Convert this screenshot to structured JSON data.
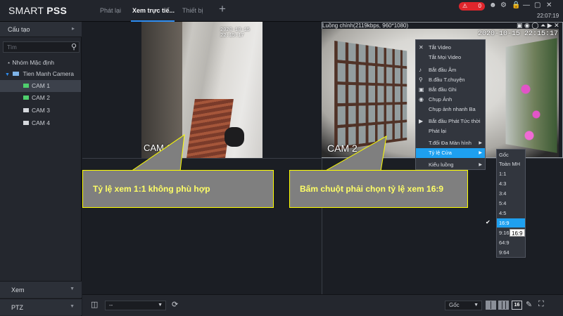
{
  "app": {
    "logo_light": "SMART ",
    "logo_bold": "PSS"
  },
  "tabs": [
    {
      "label": "Phát lại"
    },
    {
      "label": "Xem trực tiế..."
    },
    {
      "label": "Thiết bị"
    }
  ],
  "topbar": {
    "alarm_count": "0",
    "time": "22:07:19"
  },
  "sidebar": {
    "section_top": "Cấu tạo",
    "search_placeholder": "Tìm",
    "tree": [
      {
        "label": "Nhóm Mặc định"
      },
      {
        "label": "Tien Manh Camera"
      },
      {
        "label": "CAM 1"
      },
      {
        "label": "CAM 2"
      },
      {
        "label": "CAM 3"
      },
      {
        "label": "CAM 4"
      }
    ],
    "section_view": "Xem",
    "section_ptz": "PTZ"
  },
  "video": {
    "stream_info": "Luồng chính(2119kbps, 960*1080)",
    "cam1_timestamp": "2020-10-15 22:15:17",
    "cam1_label": "CAM 1",
    "cam2_timestamp": "2020-10-15 22:15:17",
    "cam2_label": "CAM 2"
  },
  "callouts": {
    "left": "Tỷ lệ xem 1:1 không phù hợp",
    "right": "Bấm chuột phải chọn tỷ lệ xem 16:9"
  },
  "context_menu": [
    {
      "label": "Tắt Video",
      "icon": "close-icon"
    },
    {
      "label": "Tắt Mọi Video",
      "icon": ""
    },
    {
      "label": "Bắt đầu Âm",
      "icon": "speaker-icon"
    },
    {
      "label": "B.đầu T.chuyện",
      "icon": "microphone-icon"
    },
    {
      "label": "Bắt đầu Ghi",
      "icon": "record-icon"
    },
    {
      "label": "Chụp Ảnh",
      "icon": "camera-icon"
    },
    {
      "label": "Chụp ảnh nhanh Ba",
      "icon": ""
    },
    {
      "label": "Bắt đầu Phát Tức thời",
      "icon": "play-circle-icon"
    },
    {
      "label": "Phát lại",
      "icon": ""
    },
    {
      "label": "T.đổi Đa Màn hình",
      "icon": ""
    },
    {
      "label": "Tỷ lệ Cửa",
      "icon": ""
    },
    {
      "label": "Kiểu luồng",
      "icon": ""
    }
  ],
  "aspect_submenu": [
    "Gốc",
    "Toàn MH",
    "1:1",
    "4:3",
    "3:4",
    "5:4",
    "4:5",
    "16:9",
    "9:16",
    "64:9",
    "9:64"
  ],
  "tooltip": "16:9",
  "bottombar": {
    "preset_value": "--",
    "ratio_value": "Gốc",
    "grid_count": "16"
  }
}
